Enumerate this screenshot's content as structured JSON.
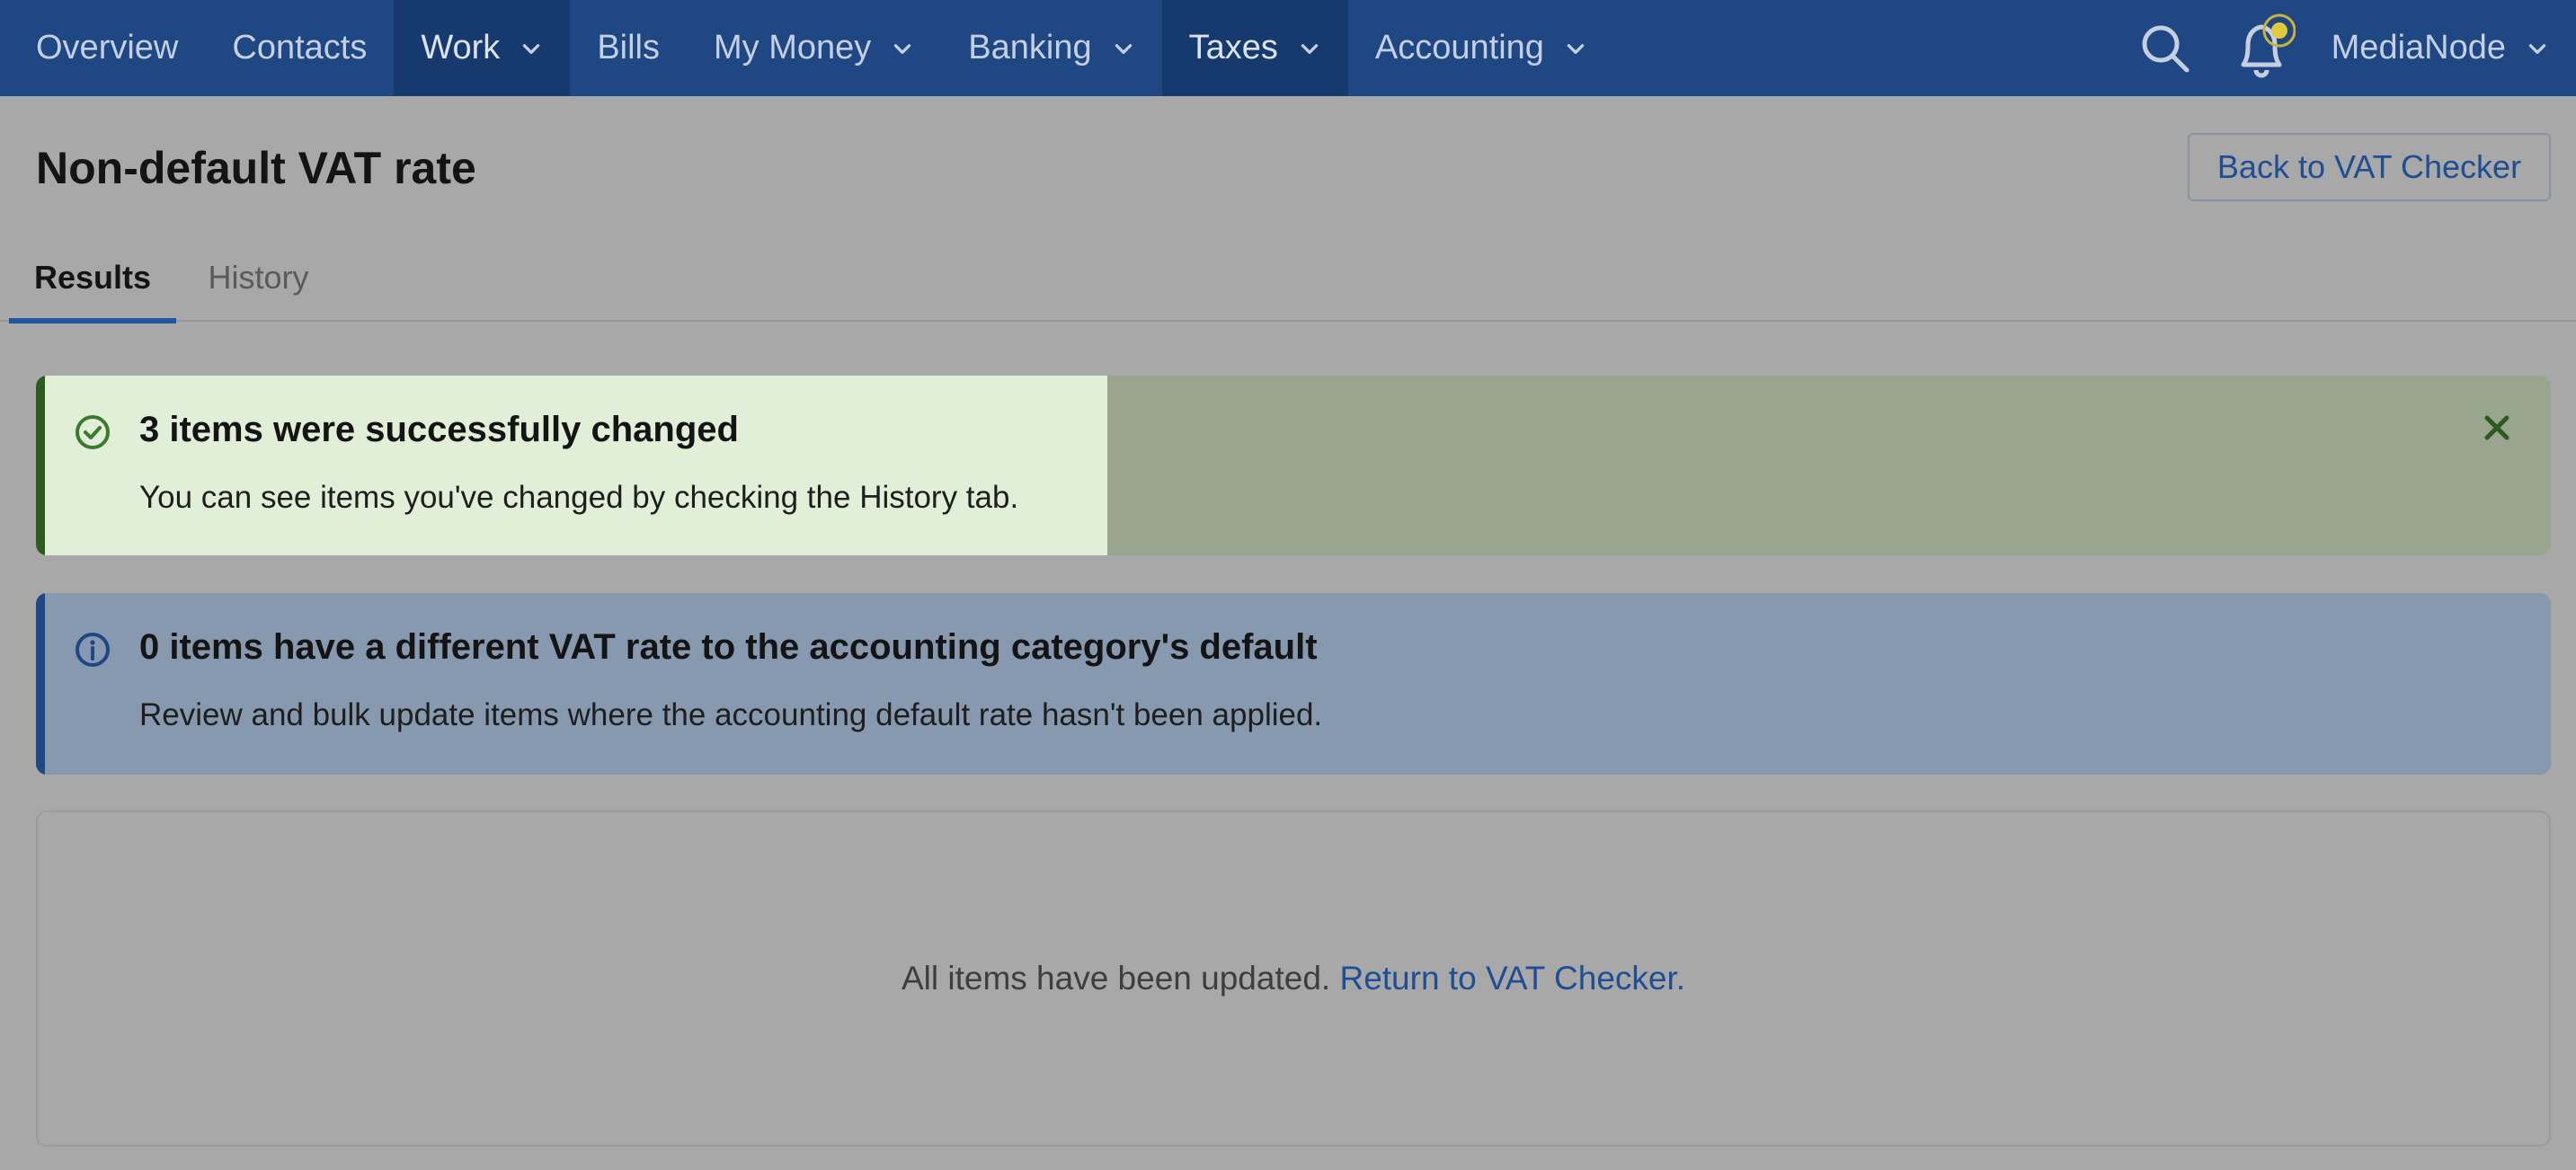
{
  "nav": {
    "items": [
      {
        "label": "Overview",
        "dropdown": false,
        "active": false
      },
      {
        "label": "Contacts",
        "dropdown": false,
        "active": false
      },
      {
        "label": "Work",
        "dropdown": true,
        "active": true
      },
      {
        "label": "Bills",
        "dropdown": false,
        "active": false
      },
      {
        "label": "My Money",
        "dropdown": true,
        "active": false
      },
      {
        "label": "Banking",
        "dropdown": true,
        "active": false
      },
      {
        "label": "Taxes",
        "dropdown": true,
        "active": true
      },
      {
        "label": "Accounting",
        "dropdown": true,
        "active": false
      }
    ],
    "account_label": "MediaNode",
    "search_icon": "search-icon",
    "notifications_icon": "bell-icon"
  },
  "page": {
    "title": "Non-default VAT rate",
    "back_button": "Back to VAT Checker"
  },
  "tabs": [
    {
      "label": "Results",
      "active": true
    },
    {
      "label": "History",
      "active": false
    }
  ],
  "success_alert": {
    "title": "3 items were successfully changed",
    "text": "You can see items you've changed by checking the History tab.",
    "icon": "check-circle-icon",
    "close_icon": "close-icon"
  },
  "info_alert": {
    "title": "0 items have a different VAT rate to the accounting category's default",
    "text": "Review and bulk update items where the accounting default rate hasn't been applied.",
    "icon": "info-icon"
  },
  "empty_state": {
    "message": "All items have been updated.",
    "link": "Return to VAT Checker."
  },
  "colors": {
    "nav_bg": "#1f4784",
    "accent": "#1f56a0",
    "success": "#2d5a1e",
    "link": "#1e4e94"
  }
}
